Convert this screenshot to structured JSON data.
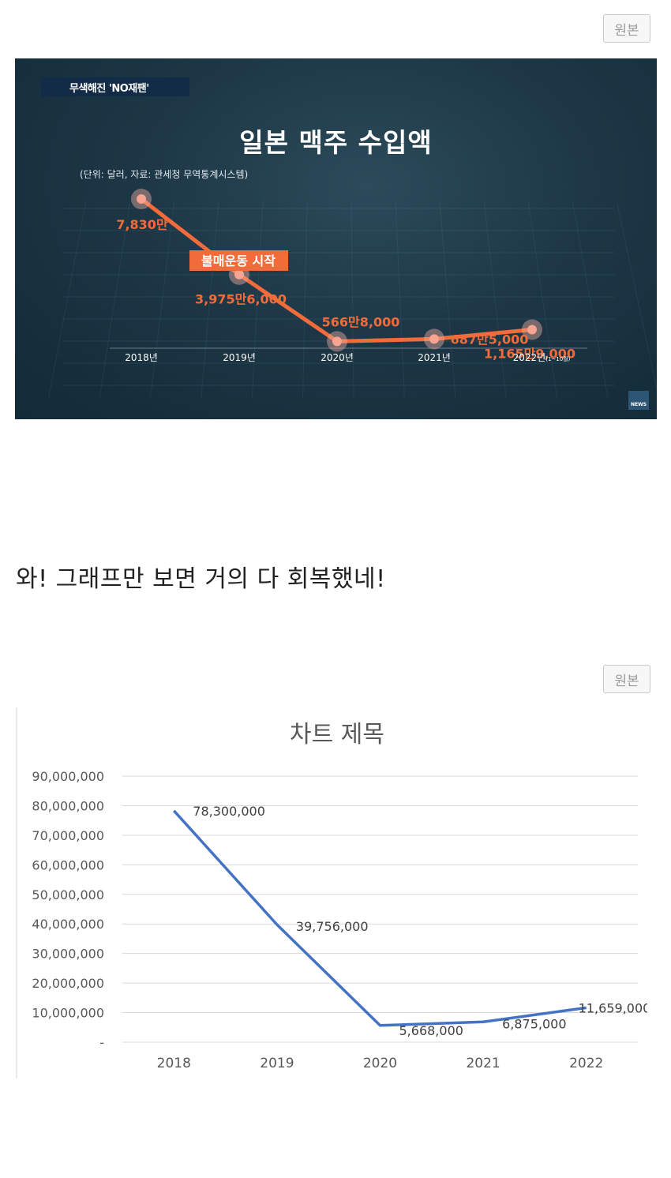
{
  "original_button_label": "원본",
  "caption": "와! 그래프만 보면 거의 다 회복했네!",
  "colors": {
    "news_line": "#f26b3a",
    "news_background": "#1d3746",
    "excel_line": "#4472c4",
    "excel_grid": "#d9d9d9"
  },
  "chart_data": [
    {
      "type": "line",
      "tag": "무색해진 'NO재팬'",
      "title": "일본 맥주 수입액",
      "subtitle": "(단위: 달러, 자료: 관세청 무역통계시스템)",
      "categories": [
        "2018년",
        "2019년",
        "2020년",
        "2021년",
        "2022년"
      ],
      "category_notes": [
        "",
        "",
        "",
        "",
        "(1~10월)"
      ],
      "values": [
        78300000,
        39756000,
        5668000,
        6875000,
        11659000
      ],
      "value_labels": [
        "7,830만",
        "3,975만6,000",
        "566만8,000",
        "687만5,000",
        "1,165만9,000"
      ],
      "annotation": "불매운동 시작",
      "logo": "NEWS"
    },
    {
      "type": "line",
      "title": "차트 제목",
      "categories": [
        "2018",
        "2019",
        "2020",
        "2021",
        "2022"
      ],
      "values": [
        78300000,
        39756000,
        5668000,
        6875000,
        11659000
      ],
      "value_labels": [
        "78,300,000",
        "39,756,000",
        "5,668,000",
        "6,875,000",
        "11,659,000"
      ],
      "y_ticks": [
        "-",
        "10,000,000",
        "20,000,000",
        "30,000,000",
        "40,000,000",
        "50,000,000",
        "60,000,000",
        "70,000,000",
        "80,000,000",
        "90,000,000"
      ],
      "ylim": [
        0,
        90000000
      ],
      "grid": true
    }
  ]
}
